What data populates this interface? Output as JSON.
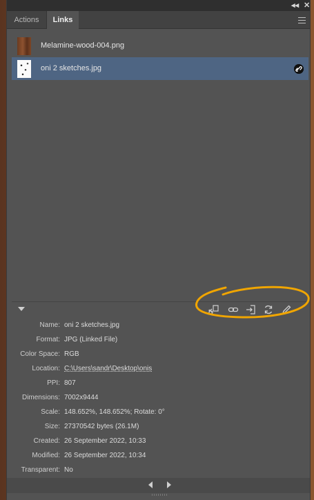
{
  "window": {
    "collapse_glyph": "◂◂",
    "close_glyph": "✕"
  },
  "tabs": [
    {
      "label": "Actions",
      "active": false
    },
    {
      "label": "Links",
      "active": true
    }
  ],
  "links": [
    {
      "filename": "Melamine-wood-004.png",
      "thumb": "wood-texture",
      "linked": false,
      "selected": false
    },
    {
      "filename": "oni 2 sketches.jpg",
      "thumb": "sketch",
      "linked": true,
      "selected": true,
      "badge_glyph": "🔗"
    }
  ],
  "toolbar": {
    "icons": [
      "relink-from-cc-libraries-icon",
      "relink-icon",
      "go-to-link-icon",
      "update-link-icon",
      "edit-original-icon"
    ]
  },
  "info": {
    "name_label": "Name:",
    "name": "oni 2 sketches.jpg",
    "format_label": "Format:",
    "format": "JPG (Linked File)",
    "color_space_label": "Color Space:",
    "color_space": "RGB",
    "location_label": "Location:",
    "location": "C:\\Users\\sandr\\Desktop\\onis",
    "ppi_label": "PPI:",
    "ppi": "807",
    "dimensions_label": "Dimensions:",
    "dimensions": "7002x9444",
    "scale_label": "Scale:",
    "scale": "148.652%, 148.652%; Rotate: 0°",
    "size_label": "Size:",
    "size": "27370542 bytes (26.1M)",
    "created_label": "Created:",
    "created": "26 September 2022, 10:33",
    "modified_label": "Modified:",
    "modified": "26 September 2022, 10:34",
    "transparent_label": "Transparent:",
    "transparent": "No"
  },
  "colors": {
    "panel": "#535353",
    "selection": "#4e6583",
    "annotation": "#f0a500"
  }
}
